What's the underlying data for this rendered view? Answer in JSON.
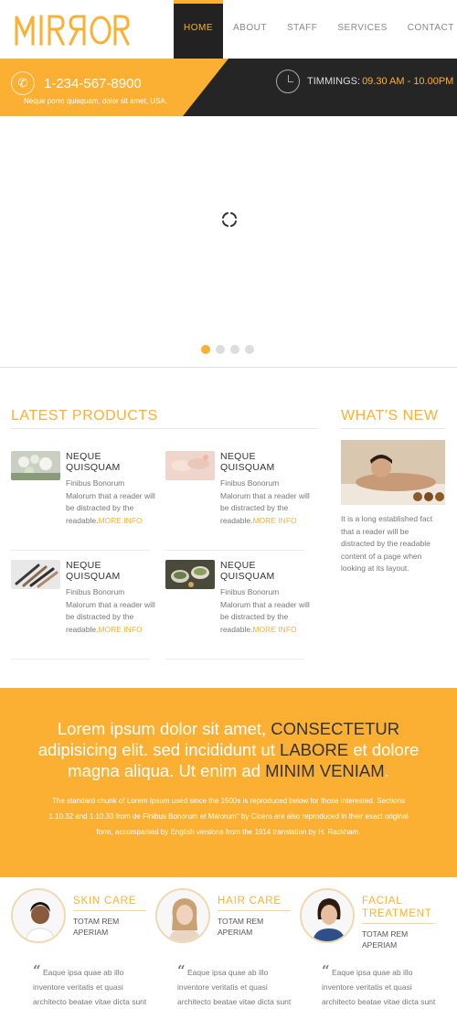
{
  "brand": {
    "logo_text": "MIRROR",
    "accent": "#fbb034",
    "dark": "#252525"
  },
  "nav": [
    {
      "label": "HOME",
      "active": true
    },
    {
      "label": "ABOUT"
    },
    {
      "label": "STAFF"
    },
    {
      "label": "SERVICES"
    },
    {
      "label": "CONTACT"
    }
  ],
  "infobar": {
    "phone": "1-234-567-8900",
    "tagline": "Neque porro quisquam, dolor sit amet, USA.",
    "timing_label": "TIMMINGS:",
    "timing_value": "09.30 AM - 10.00PM"
  },
  "slider": {
    "dots": 4,
    "active_dot": 1
  },
  "latest": {
    "title": "LATEST PRODUCTS",
    "products": [
      {
        "title": "NEQUE QUISQUAM",
        "desc": "Finibus Bonorum Malorum that a reader will be distracted by the readable.",
        "more": "MORE INFO",
        "image": "flowers-spa-thumb"
      },
      {
        "title": "NEQUE QUISQUAM",
        "desc": "Finibus Bonorum Malorum that a reader will be distracted by the readable.",
        "more": "MORE INFO",
        "image": "manicure-thumb"
      },
      {
        "title": "NEQUE QUISQUAM",
        "desc": "Finibus Bonorum Malorum that a reader will be distracted by the readable.",
        "more": "MORE INFO",
        "image": "makeup-brushes-thumb"
      },
      {
        "title": "NEQUE QUISQUAM",
        "desc": "Finibus Bonorum Malorum that a reader will be distracted by the readable.",
        "more": "MORE INFO",
        "image": "spa-bowls-thumb"
      }
    ]
  },
  "whats_new": {
    "title": "WHAT'S NEW",
    "text": "It is a long established fact that a reader will be distracted by the readable content of a page when looking at its layout."
  },
  "banner": {
    "head_1": "Lorem ipsum dolor sit amet, ",
    "head_2": "CONSECTETUR",
    "head_3": " adipisicing elit. sed incididunt ut ",
    "head_4": "LABORE",
    "head_5": " et dolore magna aliqua. Ut enim ad ",
    "head_6": "MINIM VENIAM",
    "head_7": ".",
    "body": "The standard chunk of Lorem Ipsum used since the 1500s is reproduced below for those interested. Sections 1.10.32 and 1.10.33 from de Finibus Bonorum et Malorum\" by Cicero are also reproduced in their exact original form, accompanied by English versions from the 1914 translation by H. Rackham."
  },
  "services": [
    {
      "title": "SKIN CARE",
      "sub": "TOTAM REM APERIAM",
      "quote": "Eaque ipsa quae ab illo inventore veritatis et quasi architecto beatae vitae dicta sunt"
    },
    {
      "title": "HAIR CARE",
      "sub": "TOTAM REM APERIAM",
      "quote": "Eaque ipsa quae ab illo inventore veritatis et quasi architecto beatae vitae dicta sunt"
    },
    {
      "title": "FACIAL TREATMENT",
      "sub": "TOTAM REM APERIAM",
      "quote": "Eaque ipsa quae ab illo inventore veritatis et quasi architecto beatae vitae dicta sunt"
    }
  ]
}
